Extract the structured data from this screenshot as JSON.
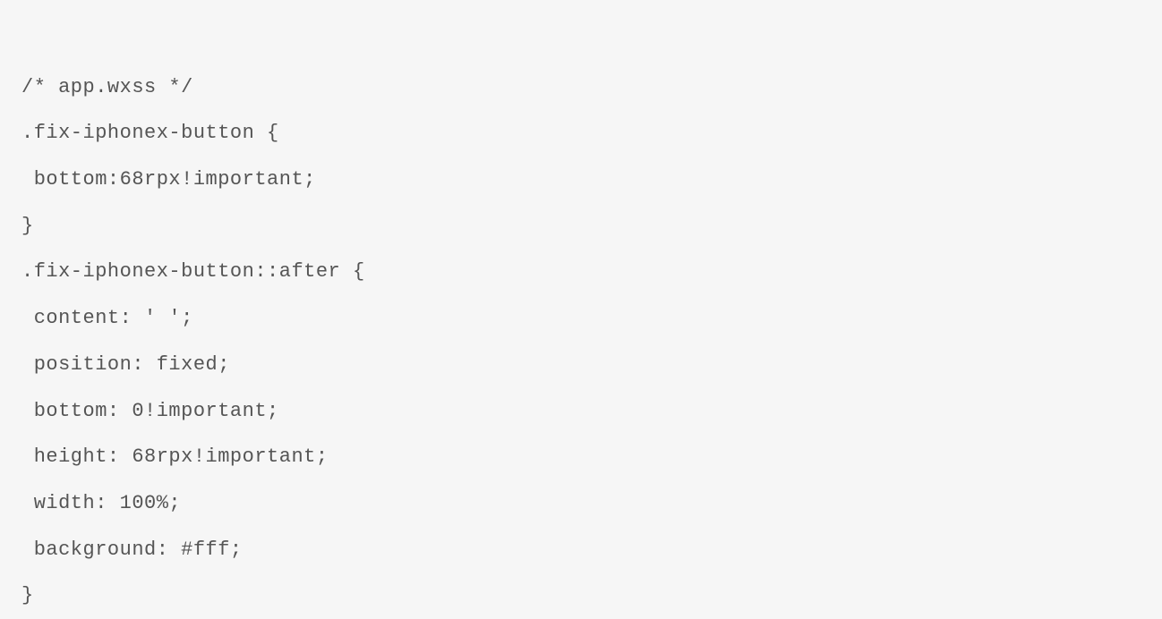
{
  "code": {
    "line1": "/* app.wxss */",
    "line2": ".fix-iphonex-button {",
    "line3": " bottom:68rpx!important;",
    "line4": "}",
    "line5": ".fix-iphonex-button::after {",
    "line6": " content: ' ';",
    "line7": " position: fixed;",
    "line8": " bottom: 0!important;",
    "line9": " height: 68rpx!important;",
    "line10": " width: 100%;",
    "line11": " background: #fff;",
    "line12": "}"
  }
}
